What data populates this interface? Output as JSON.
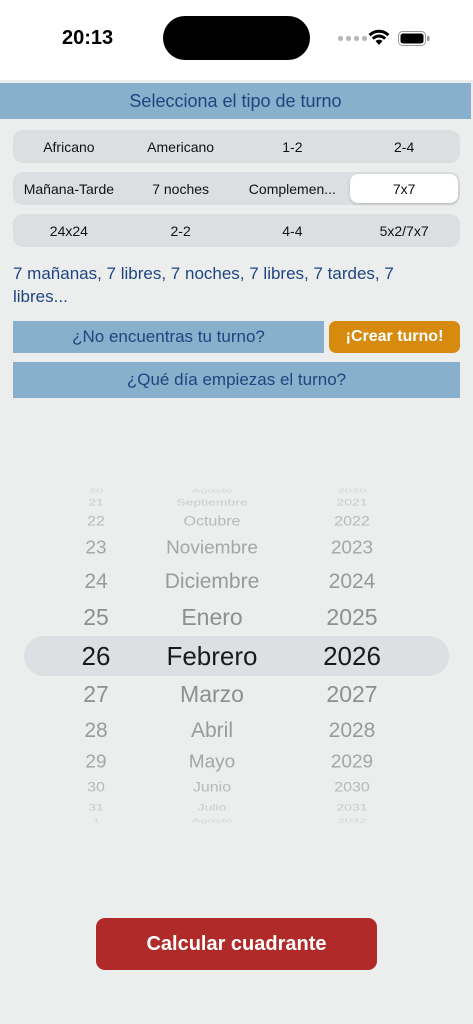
{
  "status_bar": {
    "time": "20:13"
  },
  "header": {
    "title": "Selecciona el tipo de turno"
  },
  "shift_types": {
    "rows": [
      [
        "Africano",
        "Americano",
        "1-2",
        "2-4"
      ],
      [
        "Mañana-Tarde",
        "7 noches",
        "Complemen...",
        "7x7"
      ],
      [
        "24x24",
        "2-2",
        "4-4",
        "5x2/7x7"
      ]
    ],
    "selected": "7x7"
  },
  "description": "7 mañanas, 7 libres, 7 noches, 7 libres, 7 tardes, 7 libres...",
  "not_found_label": "¿No encuentras tu turno?",
  "create_button": "¡Crear turno!",
  "start_day_label": "¿Qué día empiezas el turno?",
  "date_picker": {
    "days": [
      "20",
      "21",
      "22",
      "23",
      "24",
      "25",
      "26",
      "27",
      "28",
      "29",
      "30",
      "31",
      "1"
    ],
    "months": [
      "Agosto",
      "Septiembre",
      "Octubre",
      "Noviembre",
      "Diciembre",
      "Enero",
      "Febrero",
      "Marzo",
      "Abril",
      "Mayo",
      "Junio",
      "Julio",
      "Agosto"
    ],
    "years": [
      "2020",
      "2021",
      "2022",
      "2023",
      "2024",
      "2025",
      "2026",
      "2027",
      "2028",
      "2029",
      "2030",
      "2031",
      "2032"
    ],
    "selected_day": "26",
    "selected_month": "Febrero",
    "selected_year": "2026"
  },
  "calculate_button": "Calcular cuadrante",
  "colors": {
    "section_bar": "#88afcb",
    "accent_text": "#1f4580",
    "create_button": "#d68a0e",
    "calculate_button": "#b02a29"
  }
}
